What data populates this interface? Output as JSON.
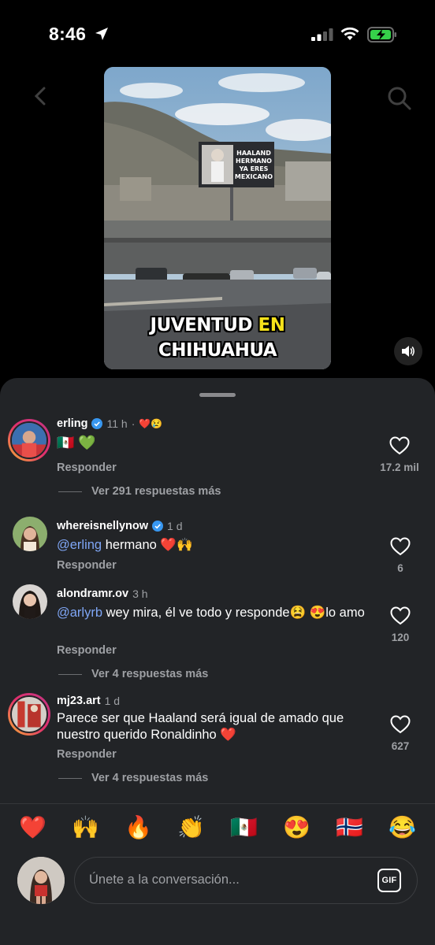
{
  "status_bar": {
    "time": "8:46"
  },
  "video": {
    "caption_line1_a": "JUVENTUD",
    "caption_line1_b": "EN",
    "caption_line2": "CHIHUAHUA",
    "billboard_lines": [
      "HAALAND",
      "HERMANO",
      "YA ERES",
      "MEXICANO"
    ]
  },
  "comments": [
    {
      "user": "erling",
      "verified": true,
      "ago": "11 h",
      "creator_like": "❤️😢",
      "text": "🇲🇽 💚",
      "reply_label": "Responder",
      "likes": "17.2 mil",
      "view_more": "Ver 291 respuestas más"
    },
    {
      "user": "whereisnellynow",
      "verified": true,
      "ago": "1 d",
      "mention": "@erling",
      "text": " hermano ❤️🙌",
      "reply_label": "Responder",
      "likes": "6"
    },
    {
      "user": "alondramr.ov",
      "verified": false,
      "ago": "3 h",
      "mention": "@arlyrb",
      "text": " wey mira, él ve todo y responde😫 😍lo amo",
      "reply_label": "Responder",
      "likes": "120",
      "view_more": "Ver 4 respuestas más"
    },
    {
      "user": "mj23.art",
      "verified": false,
      "ago": "1 d",
      "text": "Parece ser que Haaland  será igual de amado que nuestro querido Ronaldinho ❤️",
      "reply_label": "Responder",
      "likes": "627",
      "view_more": "Ver 4 respuestas más"
    }
  ],
  "emoji_bar": [
    "❤️",
    "🙌",
    "🔥",
    "👏",
    "🇲🇽",
    "😍",
    "🇳🇴",
    "😂"
  ],
  "composer": {
    "placeholder": "Únete a la conversación...",
    "gif_label": "GIF"
  },
  "colors": {
    "sheet_bg": "#222427",
    "mention": "#7fa6f5",
    "verified": "#3897f0",
    "caption_highlight": "#f6e21a"
  }
}
